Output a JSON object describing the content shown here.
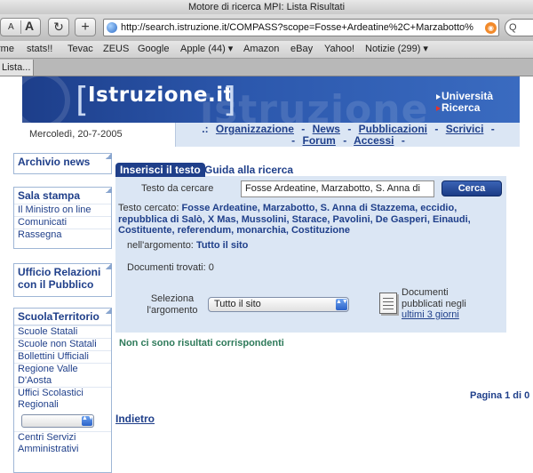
{
  "browser": {
    "window_title": "Motore di ricerca MPI: Lista Risultati",
    "font_small": "A",
    "font_large": "A",
    "reload_glyph": "↻",
    "add_glyph": "+",
    "url": "http://search.istruzione.it/COMPASS?scope=Fosse+Ardeatine%2C+Marzabotto%",
    "search_glyph": "Q",
    "bookmarks": [
      "rme",
      "stats!!",
      "Tevac",
      "ZEUS",
      "Google",
      "Apple (44) ▾",
      "Amazon",
      "eBay",
      "Yahoo!",
      "Notizie (299) ▾"
    ],
    "tab_label": "Lista..."
  },
  "banner": {
    "logo": "Istruzione.it",
    "watermark": "istruzione",
    "brace_left": "[",
    "brace_right": "]",
    "mini_1": "Università",
    "mini_2": "Ricerca"
  },
  "header": {
    "date": "Mercoledì, 20-7-2005",
    "nav_prefix": ".:",
    "nav_sep": "-",
    "nav": [
      "Organizzazione",
      "News",
      "Pubblicazioni",
      "Scrivici",
      "Forum",
      "Accessi"
    ]
  },
  "sidebar": {
    "archivio": "Archivio news",
    "stampa_title": "Sala stampa",
    "stampa_items": [
      "Il Ministro on line",
      "Comunicati",
      "Rassegna"
    ],
    "urp": "Ufficio Relazioni con il Pubblico",
    "scuola_title": "ScuolaTerritorio",
    "scuola_items": [
      "Scuole Statali",
      "Scuole non Statali",
      "Bollettini Ufficiali",
      "Regione Valle D'Aosta",
      "Uffici Scolastici Regionali"
    ],
    "scuola_footer": "Centri Servizi Amministrativi",
    "select_arrows": "▲▼"
  },
  "search": {
    "tab_active": "Inserisci il testo",
    "tab_inactive": "Guida alla ricerca",
    "label_testo": "Testo da cercare",
    "query": "Fosse Ardeatine, Marzabotto, S. Anna di",
    "button": "Cerca",
    "cercato_label": "Testo cercato:",
    "cercato_value": "Fosse Ardeatine, Marzabotto, S. Anna di Stazzema, eccidio, repubblica di Salò, X Mas, Mussolini, Starace, Pavolini, De Gasperi, Einaudi, Costituente, referendum, monarchia, Costituzione",
    "argomento_label": "nell'argomento:",
    "argomento_value": "Tutto il sito",
    "trovati": "Documenti trovati: 0",
    "select_label": "Seleziona l'argomento",
    "select_value": "Tutto il sito",
    "select_arrows": "▲▼",
    "docs_line1": "Documenti",
    "docs_line2": "pubblicati negli",
    "docs_link": "ultimi 3 giorni"
  },
  "results": {
    "none": "Non ci sono risultati corrispondenti",
    "pagination": "Pagina 1 di 0",
    "back": "Indietro"
  }
}
